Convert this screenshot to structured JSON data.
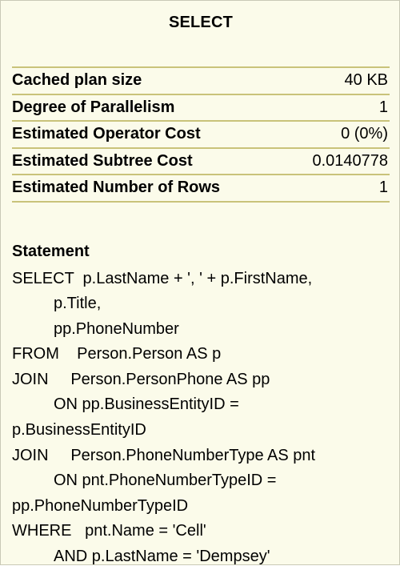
{
  "tooltip": {
    "title": "SELECT",
    "properties": [
      {
        "label": "Cached plan size",
        "value": "40 KB"
      },
      {
        "label": "Degree of Parallelism",
        "value": "1"
      },
      {
        "label": "Estimated Operator Cost",
        "value": "0 (0%)"
      },
      {
        "label": "Estimated Subtree Cost",
        "value": "0.0140778"
      },
      {
        "label": "Estimated Number of Rows",
        "value": "1"
      }
    ],
    "statement_heading": "Statement",
    "statement_lines": [
      "SELECT  p.LastName + ', ' + p.FirstName,",
      "p.Title,",
      "pp.PhoneNumber",
      "FROM    Person.Person AS p",
      "JOIN     Person.PersonPhone AS pp",
      "ON pp.BusinessEntityID =",
      "p.BusinessEntityID",
      "JOIN     Person.PhoneNumberType AS pnt",
      "ON pnt.PhoneNumberTypeID =",
      "pp.PhoneNumberTypeID",
      "WHERE   pnt.Name = 'Cell'",
      "AND p.LastName = 'Dempsey'"
    ]
  }
}
